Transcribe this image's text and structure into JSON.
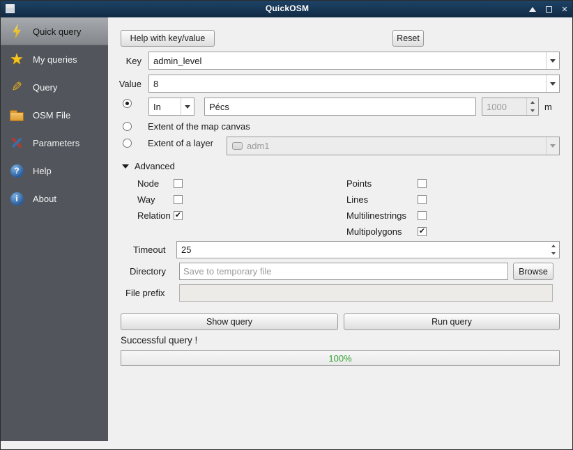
{
  "window": {
    "title": "QuickOSM"
  },
  "sidebar": {
    "items": [
      {
        "label": "Quick query",
        "icon": "lightning-icon",
        "selected": true
      },
      {
        "label": "My queries",
        "icon": "star-icon",
        "selected": false
      },
      {
        "label": "Query",
        "icon": "pencil-icon",
        "selected": false
      },
      {
        "label": "OSM File",
        "icon": "folder-icon",
        "selected": false
      },
      {
        "label": "Parameters",
        "icon": "tools-icon",
        "selected": false
      },
      {
        "label": "Help",
        "icon": "help-icon",
        "selected": false
      },
      {
        "label": "About",
        "icon": "info-icon",
        "selected": false
      }
    ]
  },
  "header": {
    "help_button": "Help with key/value",
    "reset_button": "Reset"
  },
  "query": {
    "key_label": "Key",
    "key_value": "admin_level",
    "value_label": "Value",
    "value_value": "8",
    "in_label": "In",
    "place_value": "Pécs",
    "distance_value": "1000",
    "distance_unit": "m",
    "extent_canvas_label": "Extent of the map canvas",
    "extent_layer_label": "Extent of a layer",
    "layer_value": "adm1"
  },
  "advanced": {
    "label": "Advanced",
    "osm_types": [
      {
        "label": "Node",
        "checked": false
      },
      {
        "label": "Way",
        "checked": false
      },
      {
        "label": "Relation",
        "checked": true
      }
    ],
    "geometry_types": [
      {
        "label": "Points",
        "checked": false
      },
      {
        "label": "Lines",
        "checked": false
      },
      {
        "label": "Multilinestrings",
        "checked": false
      },
      {
        "label": "Multipolygons",
        "checked": true
      }
    ],
    "timeout_label": "Timeout",
    "timeout_value": "25",
    "directory_label": "Directory",
    "directory_placeholder": "Save to temporary file",
    "browse_button": "Browse",
    "file_prefix_label": "File prefix",
    "file_prefix_value": ""
  },
  "actions": {
    "show_query": "Show query",
    "run_query": "Run query"
  },
  "status": {
    "message": "Successful query !",
    "progress_text": "100%",
    "progress_color": "#35a335"
  }
}
